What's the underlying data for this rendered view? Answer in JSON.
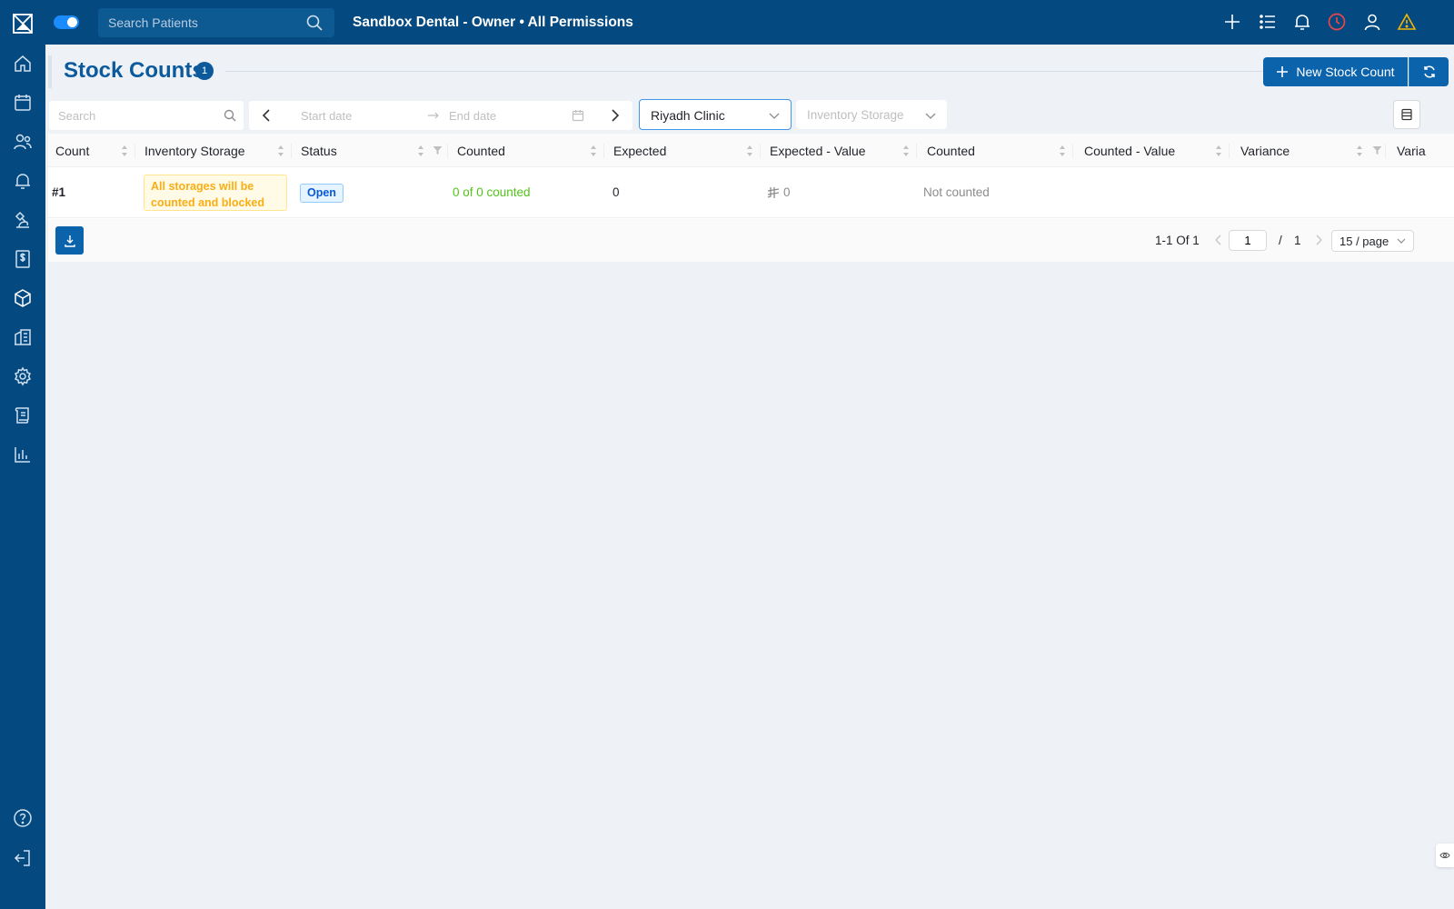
{
  "topbar": {
    "search_placeholder": "Search Patients",
    "title": "Sandbox Dental - Owner • All Permissions",
    "icons": [
      "plus-icon",
      "list-icon",
      "bell-icon",
      "clock-icon",
      "user-icon",
      "warning-icon"
    ]
  },
  "sidebar": {
    "items": [
      "home-icon",
      "calendar-icon",
      "users-icon",
      "bell-icon",
      "microscope-icon",
      "invoice-icon",
      "box-icon",
      "building-icon",
      "gear-icon",
      "ledger-icon",
      "chart-icon"
    ],
    "bottom": [
      "help-icon",
      "logout-icon"
    ]
  },
  "page": {
    "title": "Stock Counts",
    "count": "1",
    "new_button": "New Stock Count"
  },
  "filters": {
    "search_placeholder": "Search",
    "start_placeholder": "Start date",
    "end_placeholder": "End date",
    "clinic_value": "Riyadh Clinic",
    "storage_placeholder": "Inventory Storage"
  },
  "table": {
    "columns": [
      "Count",
      "Inventory Storage",
      "Status",
      "Counted",
      "Expected",
      "Expected - Value",
      "Counted",
      "Counted - Value",
      "Variance",
      "Varia"
    ],
    "rows": [
      {
        "count": "#1",
        "storage": "All storages will be counted and blocked",
        "status": "Open",
        "counted": "0 of 0 counted",
        "expected": "0",
        "expected_value": "0",
        "counted2": "Not counted"
      }
    ]
  },
  "pagination": {
    "range": "1-1 Of 1",
    "current": "1",
    "slash": "/",
    "total_pages": "1",
    "page_size": "15 / page"
  },
  "colors": {
    "sidebar": "#044a80",
    "primary": "#0b63ac",
    "title": "#0c5a9c",
    "success": "#52c41a",
    "warning": "#faad14",
    "alert_clock": "#e8464b",
    "alert_warning": "#f5b400"
  }
}
